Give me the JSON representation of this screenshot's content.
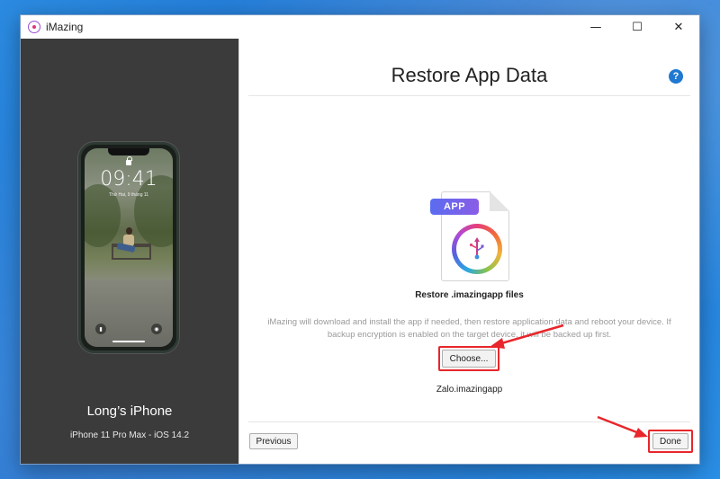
{
  "window": {
    "title": "iMazing",
    "controls": [
      "minimize",
      "maximize",
      "close"
    ]
  },
  "sidebar": {
    "device_name": "Long’s iPhone",
    "device_model": "iPhone 11 Pro Max - iOS 14.2",
    "lock_screen": {
      "time": "09:41",
      "date": "Thứ Hai, 9 tháng 11"
    }
  },
  "main": {
    "title": "Restore App Data",
    "help_label": "?",
    "file_type_tag": "APP",
    "file_caption": "Restore .imazingapp files",
    "info_text": "iMazing will download and install the app if needed, then restore application data and reboot your device. If backup encryption is enabled on the target device, it will be backed up first.",
    "choose_label": "Choose...",
    "selected_file": "Zalo.imazingapp",
    "previous_label": "Previous",
    "done_label": "Done"
  },
  "colors": {
    "accent_red": "#e8262b",
    "help_blue": "#1f78d1",
    "sidebar_bg": "#3b3b3b",
    "desktop_blue": "#1d6fd0"
  },
  "icons": {
    "app_logo": "imazing-logo-icon",
    "help": "help-icon",
    "file": "imazingapp-file-icon",
    "lock": "lock-icon",
    "flashlight": "flashlight-icon",
    "camera": "camera-icon"
  }
}
